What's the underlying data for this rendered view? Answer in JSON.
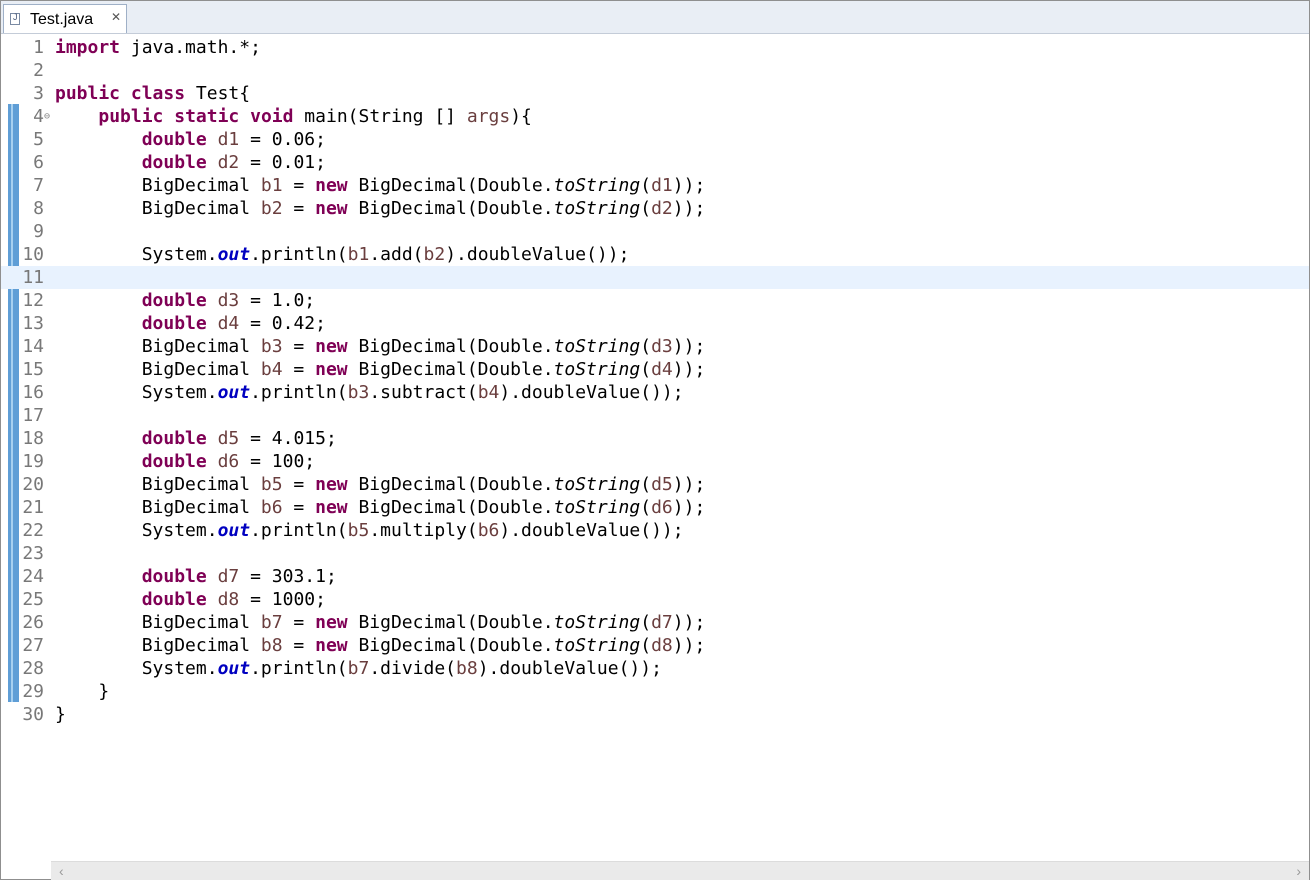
{
  "tab": {
    "label": "Test.java",
    "icon": "java-file-icon"
  },
  "code_lines": [
    {
      "n": "1",
      "seg": [
        [
          "kw",
          "import"
        ],
        [
          "p",
          " java.math.*;"
        ]
      ]
    },
    {
      "n": "2",
      "seg": []
    },
    {
      "n": "3",
      "seg": [
        [
          "kw",
          "public"
        ],
        [
          "p",
          " "
        ],
        [
          "kw",
          "class"
        ],
        [
          "p",
          " Test{"
        ]
      ]
    },
    {
      "n": "4",
      "fold": true,
      "seg": [
        [
          "p",
          "    "
        ],
        [
          "kw",
          "public"
        ],
        [
          "p",
          " "
        ],
        [
          "kw",
          "static"
        ],
        [
          "p",
          " "
        ],
        [
          "kw",
          "void"
        ],
        [
          "p",
          " main(String [] "
        ],
        [
          "var",
          "args"
        ],
        [
          "p",
          "){"
        ]
      ]
    },
    {
      "n": "5",
      "seg": [
        [
          "p",
          "        "
        ],
        [
          "kw",
          "double"
        ],
        [
          "p",
          " "
        ],
        [
          "var",
          "d1"
        ],
        [
          "p",
          " = 0.06;"
        ]
      ]
    },
    {
      "n": "6",
      "seg": [
        [
          "p",
          "        "
        ],
        [
          "kw",
          "double"
        ],
        [
          "p",
          " "
        ],
        [
          "var",
          "d2"
        ],
        [
          "p",
          " = 0.01;"
        ]
      ]
    },
    {
      "n": "7",
      "seg": [
        [
          "p",
          "        BigDecimal "
        ],
        [
          "var",
          "b1"
        ],
        [
          "p",
          " = "
        ],
        [
          "kw",
          "new"
        ],
        [
          "p",
          " BigDecimal(Double."
        ],
        [
          "sm",
          "toString"
        ],
        [
          "p",
          "("
        ],
        [
          "var",
          "d1"
        ],
        [
          "p",
          "));"
        ]
      ]
    },
    {
      "n": "8",
      "seg": [
        [
          "p",
          "        BigDecimal "
        ],
        [
          "var",
          "b2"
        ],
        [
          "p",
          " = "
        ],
        [
          "kw",
          "new"
        ],
        [
          "p",
          " BigDecimal(Double."
        ],
        [
          "sm",
          "toString"
        ],
        [
          "p",
          "("
        ],
        [
          "var",
          "d2"
        ],
        [
          "p",
          "));"
        ]
      ]
    },
    {
      "n": "9",
      "seg": []
    },
    {
      "n": "10",
      "seg": [
        [
          "p",
          "        System."
        ],
        [
          "fld",
          "out"
        ],
        [
          "p",
          ".println("
        ],
        [
          "var",
          "b1"
        ],
        [
          "p",
          ".add("
        ],
        [
          "var",
          "b2"
        ],
        [
          "p",
          ").doubleValue());"
        ]
      ]
    },
    {
      "n": "11",
      "current": true,
      "seg": []
    },
    {
      "n": "12",
      "seg": [
        [
          "p",
          "        "
        ],
        [
          "kw",
          "double"
        ],
        [
          "p",
          " "
        ],
        [
          "var",
          "d3"
        ],
        [
          "p",
          " = 1.0;"
        ]
      ]
    },
    {
      "n": "13",
      "seg": [
        [
          "p",
          "        "
        ],
        [
          "kw",
          "double"
        ],
        [
          "p",
          " "
        ],
        [
          "var",
          "d4"
        ],
        [
          "p",
          " = 0.42;"
        ]
      ]
    },
    {
      "n": "14",
      "seg": [
        [
          "p",
          "        BigDecimal "
        ],
        [
          "var",
          "b3"
        ],
        [
          "p",
          " = "
        ],
        [
          "kw",
          "new"
        ],
        [
          "p",
          " BigDecimal(Double."
        ],
        [
          "sm",
          "toString"
        ],
        [
          "p",
          "("
        ],
        [
          "var",
          "d3"
        ],
        [
          "p",
          "));"
        ]
      ]
    },
    {
      "n": "15",
      "seg": [
        [
          "p",
          "        BigDecimal "
        ],
        [
          "var",
          "b4"
        ],
        [
          "p",
          " = "
        ],
        [
          "kw",
          "new"
        ],
        [
          "p",
          " BigDecimal(Double."
        ],
        [
          "sm",
          "toString"
        ],
        [
          "p",
          "("
        ],
        [
          "var",
          "d4"
        ],
        [
          "p",
          "));"
        ]
      ]
    },
    {
      "n": "16",
      "seg": [
        [
          "p",
          "        System."
        ],
        [
          "fld",
          "out"
        ],
        [
          "p",
          ".println("
        ],
        [
          "var",
          "b3"
        ],
        [
          "p",
          ".subtract("
        ],
        [
          "var",
          "b4"
        ],
        [
          "p",
          ").doubleValue());"
        ]
      ]
    },
    {
      "n": "17",
      "seg": []
    },
    {
      "n": "18",
      "seg": [
        [
          "p",
          "        "
        ],
        [
          "kw",
          "double"
        ],
        [
          "p",
          " "
        ],
        [
          "var",
          "d5"
        ],
        [
          "p",
          " = 4.015;"
        ]
      ]
    },
    {
      "n": "19",
      "seg": [
        [
          "p",
          "        "
        ],
        [
          "kw",
          "double"
        ],
        [
          "p",
          " "
        ],
        [
          "var",
          "d6"
        ],
        [
          "p",
          " = 100;"
        ]
      ]
    },
    {
      "n": "20",
      "seg": [
        [
          "p",
          "        BigDecimal "
        ],
        [
          "var",
          "b5"
        ],
        [
          "p",
          " = "
        ],
        [
          "kw",
          "new"
        ],
        [
          "p",
          " BigDecimal(Double."
        ],
        [
          "sm",
          "toString"
        ],
        [
          "p",
          "("
        ],
        [
          "var",
          "d5"
        ],
        [
          "p",
          "));"
        ]
      ]
    },
    {
      "n": "21",
      "seg": [
        [
          "p",
          "        BigDecimal "
        ],
        [
          "var",
          "b6"
        ],
        [
          "p",
          " = "
        ],
        [
          "kw",
          "new"
        ],
        [
          "p",
          " BigDecimal(Double."
        ],
        [
          "sm",
          "toString"
        ],
        [
          "p",
          "("
        ],
        [
          "var",
          "d6"
        ],
        [
          "p",
          "));"
        ]
      ]
    },
    {
      "n": "22",
      "seg": [
        [
          "p",
          "        System."
        ],
        [
          "fld",
          "out"
        ],
        [
          "p",
          ".println("
        ],
        [
          "var",
          "b5"
        ],
        [
          "p",
          ".multiply("
        ],
        [
          "var",
          "b6"
        ],
        [
          "p",
          ").doubleValue());"
        ]
      ]
    },
    {
      "n": "23",
      "seg": []
    },
    {
      "n": "24",
      "seg": [
        [
          "p",
          "        "
        ],
        [
          "kw",
          "double"
        ],
        [
          "p",
          " "
        ],
        [
          "var",
          "d7"
        ],
        [
          "p",
          " = 303.1;"
        ]
      ]
    },
    {
      "n": "25",
      "seg": [
        [
          "p",
          "        "
        ],
        [
          "kw",
          "double"
        ],
        [
          "p",
          " "
        ],
        [
          "var",
          "d8"
        ],
        [
          "p",
          " = 1000;"
        ]
      ]
    },
    {
      "n": "26",
      "seg": [
        [
          "p",
          "        BigDecimal "
        ],
        [
          "var",
          "b7"
        ],
        [
          "p",
          " = "
        ],
        [
          "kw",
          "new"
        ],
        [
          "p",
          " BigDecimal(Double."
        ],
        [
          "sm",
          "toString"
        ],
        [
          "p",
          "("
        ],
        [
          "var",
          "d7"
        ],
        [
          "p",
          "));"
        ]
      ]
    },
    {
      "n": "27",
      "seg": [
        [
          "p",
          "        BigDecimal "
        ],
        [
          "var",
          "b8"
        ],
        [
          "p",
          " = "
        ],
        [
          "kw",
          "new"
        ],
        [
          "p",
          " BigDecimal(Double."
        ],
        [
          "sm",
          "toString"
        ],
        [
          "p",
          "("
        ],
        [
          "var",
          "d8"
        ],
        [
          "p",
          "));"
        ]
      ]
    },
    {
      "n": "28",
      "seg": [
        [
          "p",
          "        System."
        ],
        [
          "fld",
          "out"
        ],
        [
          "p",
          ".println("
        ],
        [
          "var",
          "b7"
        ],
        [
          "p",
          ".divide("
        ],
        [
          "var",
          "b8"
        ],
        [
          "p",
          ").doubleValue());"
        ]
      ]
    },
    {
      "n": "29",
      "seg": [
        [
          "p",
          "    }"
        ]
      ]
    },
    {
      "n": "30",
      "seg": [
        [
          "p",
          "}"
        ]
      ]
    }
  ],
  "colors": {
    "keyword": "#7f0055",
    "local_variable": "#6a3e3e",
    "static_field": "#0000c0",
    "current_line": "#e8f2fe",
    "change_ruler": "#5f9ed6"
  }
}
